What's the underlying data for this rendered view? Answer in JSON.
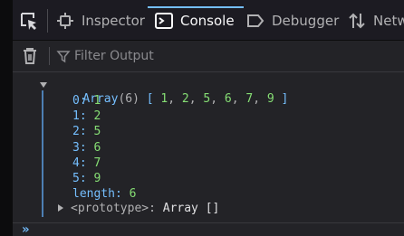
{
  "toolbar": {
    "tabs": [
      {
        "label": "Inspector",
        "icon": "inspector-icon"
      },
      {
        "label": "Console",
        "icon": "console-icon",
        "selected": true
      },
      {
        "label": "Debugger",
        "icon": "debugger-icon"
      },
      {
        "label": "Netw",
        "icon": "network-icon"
      }
    ]
  },
  "filter": {
    "placeholder": "Filter Output"
  },
  "console": {
    "array_header": {
      "type": "Array",
      "length": "(6)",
      "bracket_open": "[",
      "preview": [
        "1",
        "2",
        "5",
        "6",
        "7",
        "9"
      ],
      "bracket_close": "]"
    },
    "entries": [
      {
        "key": "0:",
        "value": "1"
      },
      {
        "key": "1:",
        "value": "2"
      },
      {
        "key": "2:",
        "value": "5"
      },
      {
        "key": "3:",
        "value": "6"
      },
      {
        "key": "4:",
        "value": "7"
      },
      {
        "key": "5:",
        "value": "9"
      }
    ],
    "length_key": "length:",
    "length_value": "6",
    "prototype_key": "<prototype>:",
    "prototype_value": "Array []"
  },
  "input": {
    "prompt": "»"
  },
  "colors": {
    "accent": "#75bfff",
    "number": "#86de74",
    "background": "#232327"
  }
}
